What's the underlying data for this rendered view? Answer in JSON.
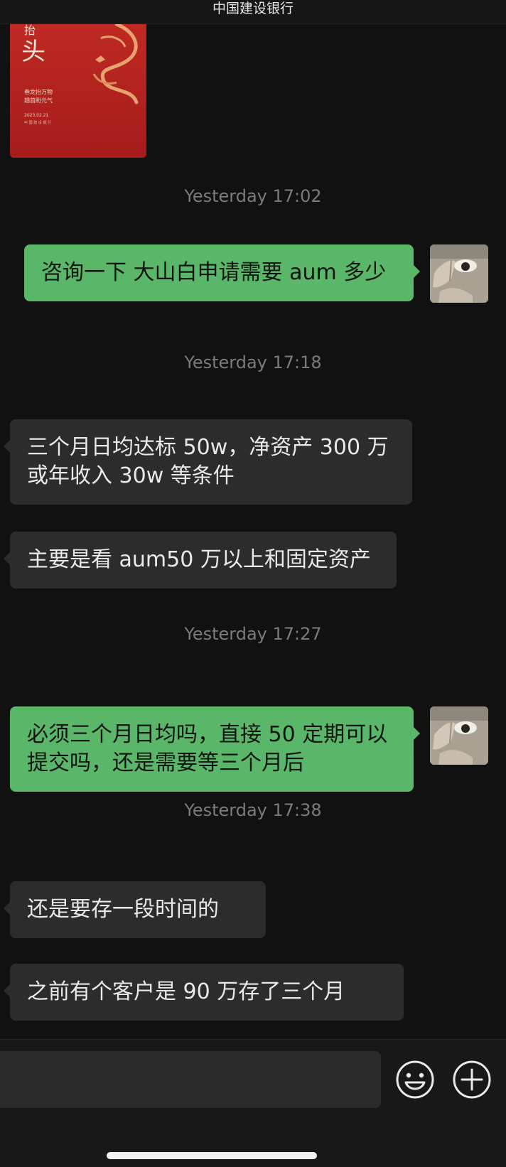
{
  "header": {
    "title": "中国建设银行"
  },
  "image_message": {
    "big_char": "头",
    "small_char": "抬",
    "lines": [
      "春龙抬万物",
      "翘首盼元气"
    ],
    "date": "2023.02.21",
    "footer": "中 国 建 设 银 行"
  },
  "messages": [
    {
      "kind": "timestamp",
      "text": "Yesterday 17:02"
    },
    {
      "kind": "outgoing",
      "text": "咨询一下 大山白申请需要 aum 多少"
    },
    {
      "kind": "timestamp",
      "text": "Yesterday 17:18"
    },
    {
      "kind": "incoming",
      "text": "三个月日均达标 50w，净资产 300 万或年收入 30w 等条件"
    },
    {
      "kind": "incoming",
      "text": "主要是看 aum50 万以上和固定资产"
    },
    {
      "kind": "timestamp",
      "text": "Yesterday 17:27"
    },
    {
      "kind": "outgoing",
      "text": "必须三个月日均吗，直接 50 定期可以提交吗，还是需要等三个月后"
    },
    {
      "kind": "timestamp",
      "text": "Yesterday 17:38"
    },
    {
      "kind": "incoming",
      "text": "还是要存一段时间的"
    },
    {
      "kind": "incoming",
      "text": "之前有个客户是 90 万存了三个月"
    }
  ],
  "composer": {
    "emoji_icon": "emoji-smile-icon",
    "plus_icon": "plus-circle-icon"
  },
  "colors": {
    "background": "#111111",
    "incoming_bubble": "#2c2c2c",
    "outgoing_bubble": "#5ab76a",
    "timestamp_text": "#7b7b7b",
    "red_card": "#b3221f"
  }
}
